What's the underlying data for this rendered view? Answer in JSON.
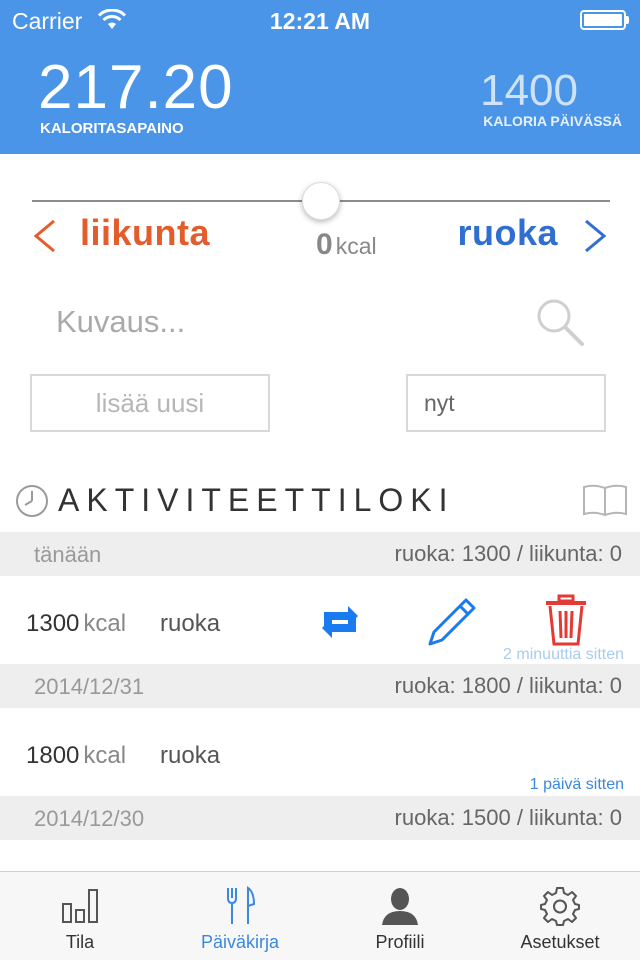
{
  "status_bar": {
    "carrier": "Carrier",
    "time": "12:21 AM"
  },
  "header": {
    "balance_value": "217.20",
    "balance_label": "KALORITASAPAINO",
    "daily_value": "1400",
    "daily_label": "KALORIA PÄIVÄSSÄ"
  },
  "mode": {
    "left_label": "liikunta",
    "right_label": "ruoka",
    "kcal_value": "0",
    "kcal_unit": "kcal",
    "slider_position": 0.5
  },
  "form": {
    "description_placeholder": "Kuvaus...",
    "add_button": "lisää uusi",
    "time_value": "nyt"
  },
  "log": {
    "title": "AKTIVITEETTILOKI",
    "days": [
      {
        "date": "tänään",
        "summary": "ruoka: 1300 / liikunta: 0",
        "entries": [
          {
            "kcal": "1300",
            "unit": "kcal",
            "type": "ruoka",
            "time": "2 minuuttia sitten"
          }
        ]
      },
      {
        "date": "2014/12/31",
        "summary": "ruoka: 1800 / liikunta: 0",
        "entries": [
          {
            "kcal": "1800",
            "unit": "kcal",
            "type": "ruoka",
            "time": "1 päivä sitten"
          }
        ]
      },
      {
        "date": "2014/12/30",
        "summary": "ruoka: 1500 / liikunta: 0",
        "entries": []
      }
    ]
  },
  "tabs": [
    {
      "label": "Tila",
      "icon": "bar-chart-icon",
      "active": false
    },
    {
      "label": "Päiväkirja",
      "icon": "fork-knife-icon",
      "active": true
    },
    {
      "label": "Profiili",
      "icon": "person-icon",
      "active": false
    },
    {
      "label": "Asetukset",
      "icon": "gear-icon",
      "active": false
    }
  ],
  "colors": {
    "header_bg": "#4a95e8",
    "exercise": "#e35c2b",
    "food": "#2f6fd1",
    "accent": "#3b88e0",
    "delete": "#e53935"
  }
}
